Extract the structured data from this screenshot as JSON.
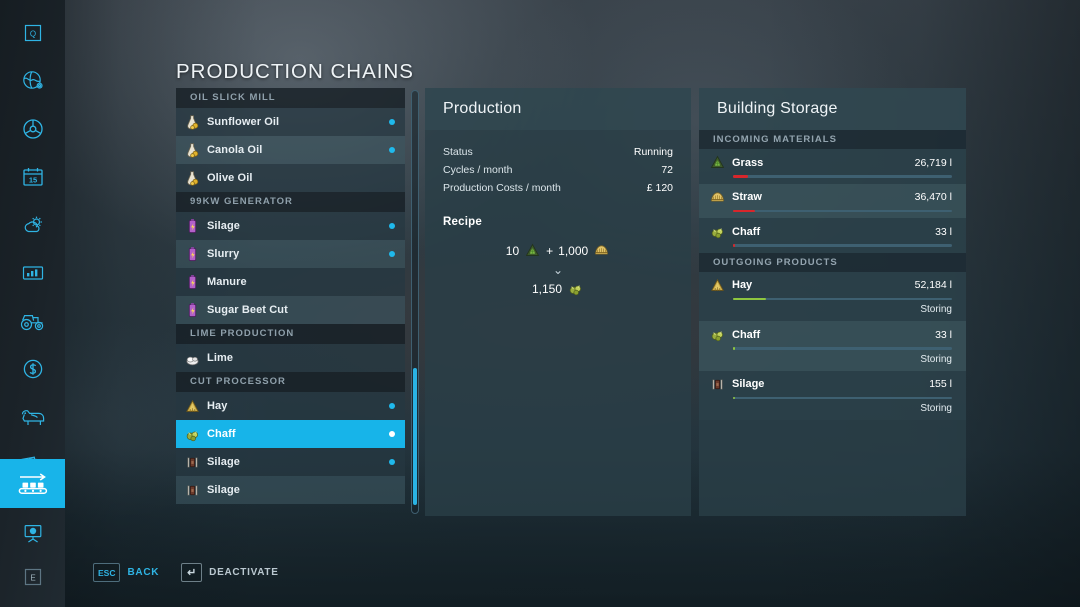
{
  "page_title": "PRODUCTION CHAINS",
  "colors": {
    "accent": "#17b4e9",
    "dot": "#1fb9ec",
    "bar_low": "#d8262b",
    "bar_ok": "#8ec63f",
    "panel": "#293e47"
  },
  "rail": {
    "items": [
      {
        "name": "quest-icon",
        "label": "Q",
        "active": false
      },
      {
        "name": "globe-icon",
        "label": "Map",
        "active": false
      },
      {
        "name": "steering-wheel-icon",
        "label": "Vehicles",
        "active": false
      },
      {
        "name": "calendar-icon",
        "label": "15",
        "active": false
      },
      {
        "name": "weather-icon",
        "label": "Weather",
        "active": false
      },
      {
        "name": "statistics-icon",
        "label": "Statistics",
        "active": false
      },
      {
        "name": "tractor-icon",
        "label": "Machines",
        "active": false
      },
      {
        "name": "finances-icon",
        "label": "Finances",
        "active": false
      },
      {
        "name": "animals-icon",
        "label": "Animals",
        "active": false
      },
      {
        "name": "contracts-icon",
        "label": "Contracts",
        "active": false
      },
      {
        "name": "production-chains-icon",
        "label": "Production Chains",
        "active": true
      },
      {
        "name": "construction-icon",
        "label": "Construction",
        "active": false
      },
      {
        "name": "exit-icon",
        "label": "E",
        "active": false
      }
    ]
  },
  "chain_list": {
    "groups": [
      {
        "title": "OIL SLICK MILL",
        "rows": [
          {
            "label": "Sunflower Oil",
            "icon": "oil-bottle-icon",
            "active": true,
            "selected": false
          },
          {
            "label": "Canola Oil",
            "icon": "oil-bottle-icon",
            "active": true,
            "selected": false
          },
          {
            "label": "Olive Oil",
            "icon": "oil-bottle-icon",
            "active": false,
            "selected": false
          }
        ]
      },
      {
        "title": "99KW GENERATOR",
        "rows": [
          {
            "label": "Silage",
            "icon": "battery-icon",
            "active": true,
            "selected": false
          },
          {
            "label": "Slurry",
            "icon": "battery-icon",
            "active": true,
            "selected": false
          },
          {
            "label": "Manure",
            "icon": "battery-icon",
            "active": false,
            "selected": false
          },
          {
            "label": "Sugar Beet Cut",
            "icon": "battery-icon",
            "active": false,
            "selected": false
          }
        ]
      },
      {
        "title": "LIME PRODUCTION",
        "rows": [
          {
            "label": "Lime",
            "icon": "lime-icon",
            "active": false,
            "selected": false
          }
        ]
      },
      {
        "title": "CUT PROCESSOR",
        "rows": [
          {
            "label": "Hay",
            "icon": "hay-icon",
            "active": true,
            "selected": false
          },
          {
            "label": "Chaff",
            "icon": "chaff-icon",
            "active": true,
            "selected": true
          },
          {
            "label": "Silage",
            "icon": "silage-icon",
            "active": true,
            "selected": false
          },
          {
            "label": "Silage",
            "icon": "silage-icon",
            "active": false,
            "selected": false
          }
        ]
      }
    ]
  },
  "production": {
    "heading": "Production",
    "stats": [
      {
        "key": "Status",
        "value": "Running"
      },
      {
        "key": "Cycles / month",
        "value": "72"
      },
      {
        "key": "Production Costs / month",
        "value": "£ 120"
      }
    ],
    "recipe_label": "Recipe",
    "recipe": {
      "inputs": [
        {
          "amount": "10",
          "icon": "grass-icon"
        },
        {
          "amount": "1,000",
          "icon": "straw-icon"
        }
      ],
      "plus": "+",
      "arrow": "⌄",
      "outputs": [
        {
          "amount": "1,150",
          "icon": "chaff-icon"
        }
      ]
    }
  },
  "storage": {
    "heading": "Building Storage",
    "sections": [
      {
        "title": "INCOMING MATERIALS",
        "rows": [
          {
            "name": "Grass",
            "icon": "grass-icon",
            "amount": "26,719 l",
            "fill_pct": 7,
            "bar_color": "#d8262b",
            "status": ""
          },
          {
            "name": "Straw",
            "icon": "straw-icon",
            "amount": "36,470 l",
            "fill_pct": 10,
            "bar_color": "#d8262b",
            "status": ""
          },
          {
            "name": "Chaff",
            "icon": "chaff-icon",
            "amount": "33 l",
            "fill_pct": 1,
            "bar_color": "#d8262b",
            "status": ""
          }
        ]
      },
      {
        "title": "OUTGOING PRODUCTS",
        "rows": [
          {
            "name": "Hay",
            "icon": "hay-icon",
            "amount": "52,184 l",
            "fill_pct": 15,
            "bar_color": "#8ec63f",
            "status": "Storing"
          },
          {
            "name": "Chaff",
            "icon": "chaff-icon",
            "amount": "33 l",
            "fill_pct": 1,
            "bar_color": "#8ec63f",
            "status": "Storing"
          },
          {
            "name": "Silage",
            "icon": "silage-icon",
            "amount": "155 l",
            "fill_pct": 1,
            "bar_color": "#8ec63f",
            "status": "Storing"
          }
        ]
      }
    ]
  },
  "helpbar": [
    {
      "key": "ESC",
      "label": "BACK",
      "style": "cyan"
    },
    {
      "key": "↵",
      "label": "DEACTIVATE",
      "style": "grey"
    }
  ]
}
